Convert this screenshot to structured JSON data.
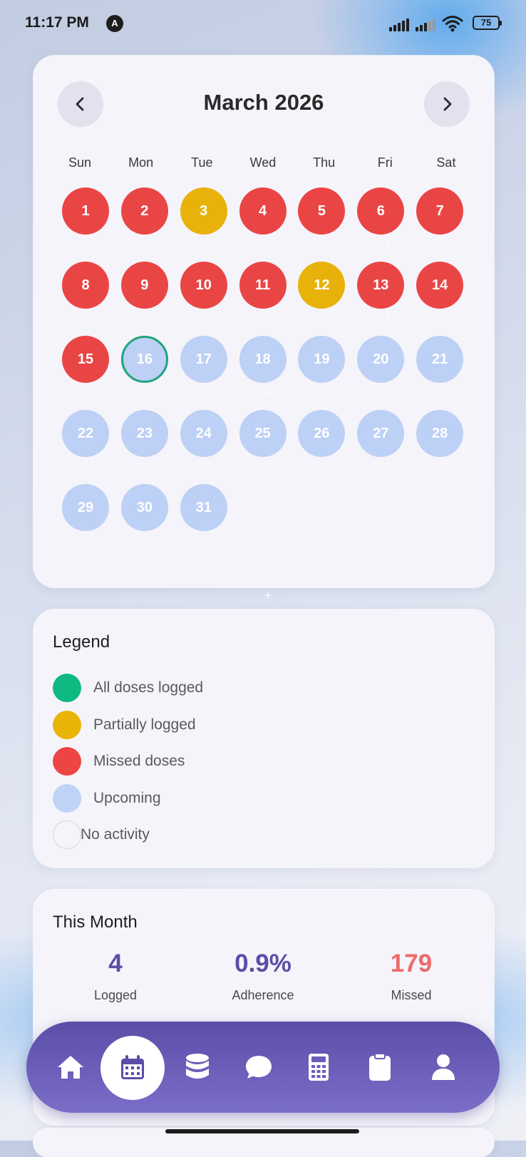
{
  "status_bar": {
    "time": "11:17 PM",
    "nav_badge": "A",
    "battery": "75"
  },
  "calendar": {
    "title": "March 2026",
    "prev_label": "previous month",
    "next_label": "next month",
    "weekdays": [
      "Sun",
      "Mon",
      "Tue",
      "Wed",
      "Thu",
      "Fri",
      "Sat"
    ],
    "today": 16,
    "days": [
      {
        "day": 1,
        "status": "missed",
        "count": "0/2"
      },
      {
        "day": 2,
        "status": "missed",
        "count": "0/3"
      },
      {
        "day": 3,
        "status": "partial",
        "count": "3/15"
      },
      {
        "day": 4,
        "status": "missed",
        "count": "0/14"
      },
      {
        "day": 5,
        "status": "missed",
        "count": "0/15"
      },
      {
        "day": 6,
        "status": "missed",
        "count": "0/14"
      },
      {
        "day": 7,
        "status": "missed",
        "count": "0/16"
      },
      {
        "day": 8,
        "status": "missed",
        "count": "0/14"
      },
      {
        "day": 9,
        "status": "missed",
        "count": "0/15"
      },
      {
        "day": 10,
        "status": "missed",
        "count": "0/15"
      },
      {
        "day": 11,
        "status": "missed",
        "count": "0/14"
      },
      {
        "day": 12,
        "status": "partial",
        "count": "1/15"
      },
      {
        "day": 13,
        "status": "missed",
        "count": "0/14"
      },
      {
        "day": 14,
        "status": "missed",
        "count": "0/15"
      },
      {
        "day": 15,
        "status": "missed",
        "count": "0/14"
      },
      {
        "day": 16,
        "status": "upcoming",
        "count": "0/15"
      },
      {
        "day": 17,
        "status": "upcoming",
        "count": "0/15"
      },
      {
        "day": 18,
        "status": "upcoming",
        "count": "0/14"
      },
      {
        "day": 19,
        "status": "upcoming",
        "count": "0/15"
      },
      {
        "day": 20,
        "status": "upcoming",
        "count": "0/14"
      },
      {
        "day": 21,
        "status": "upcoming",
        "count": "0/15"
      },
      {
        "day": 22,
        "status": "upcoming",
        "count": "0/14"
      },
      {
        "day": 23,
        "status": "upcoming",
        "count": "0/15"
      },
      {
        "day": 24,
        "status": "upcoming",
        "count": "0/15"
      },
      {
        "day": 25,
        "status": "upcoming",
        "count": "0/14"
      },
      {
        "day": 26,
        "status": "upcoming",
        "count": "0/15"
      },
      {
        "day": 27,
        "status": "upcoming",
        "count": "0/14"
      },
      {
        "day": 28,
        "status": "upcoming",
        "count": "0/15"
      },
      {
        "day": 29,
        "status": "upcoming",
        "count": "0/14"
      },
      {
        "day": 30,
        "status": "upcoming",
        "count": "0/15"
      },
      {
        "day": 31,
        "status": "upcoming",
        "count": "0/15"
      }
    ]
  },
  "legend": {
    "title": "Legend",
    "items": [
      {
        "label": "All doses logged",
        "color": "#10b981",
        "icon": "green-dot"
      },
      {
        "label": "Partially logged",
        "color": "#eab308",
        "icon": "yellow-dot"
      },
      {
        "label": "Missed doses",
        "color": "#ef4444",
        "icon": "red-dot"
      },
      {
        "label": "Upcoming",
        "color": "#bfd3f6",
        "icon": "light-blue-dot"
      },
      {
        "label": "No activity",
        "color": "transparent",
        "icon": "empty-circle"
      }
    ]
  },
  "this_month": {
    "title": "This Month",
    "stats": [
      {
        "value": "4",
        "label": "Logged",
        "color": "#5b4ea7"
      },
      {
        "value": "0.9%",
        "label": "Adherence",
        "color": "#5b4ea7"
      },
      {
        "value": "179",
        "label": "Missed",
        "color": "#ec6b6b"
      }
    ]
  },
  "bottom_nav": {
    "active": "calendar",
    "items": [
      "home-icon",
      "calendar-icon",
      "database-icon",
      "chat-icon",
      "calculator-icon",
      "clipboard-icon",
      "user-icon"
    ]
  },
  "colors": {
    "accent": "#5b4ea7",
    "missed": "#ea4545",
    "partial": "#e8b20a",
    "upcoming": "#bdd0f5",
    "today_ring": "#1ea57e"
  }
}
